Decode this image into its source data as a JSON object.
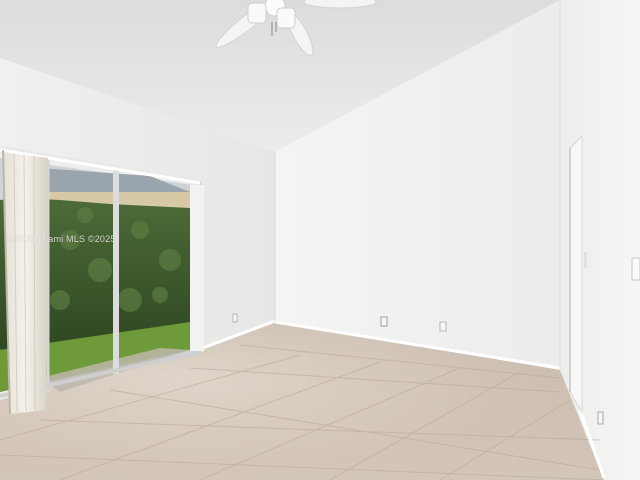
{
  "scene": {
    "description_visible": "empty room photo",
    "watermark": "©2025 Miami MLS ©2025",
    "colors": {
      "ceiling": "#e6e6e4",
      "wall_left": "#ecebea",
      "wall_back": "#f1f1ef",
      "wall_right": "#f3f3f2",
      "floor": "#cbbdb0",
      "hedge": "#3e5a2c",
      "lawn": "#6f9a3a",
      "house": "#d8c9a6",
      "baseboard": "#ffffff"
    },
    "objects": {
      "ceiling_fan": "ceiling-fan-icon",
      "sliding_door": "sliding-glass-door",
      "curtain": "vertical-blind-curtain",
      "interior_door": "white-interior-door",
      "outlets": "wall-outlet-icon"
    }
  }
}
